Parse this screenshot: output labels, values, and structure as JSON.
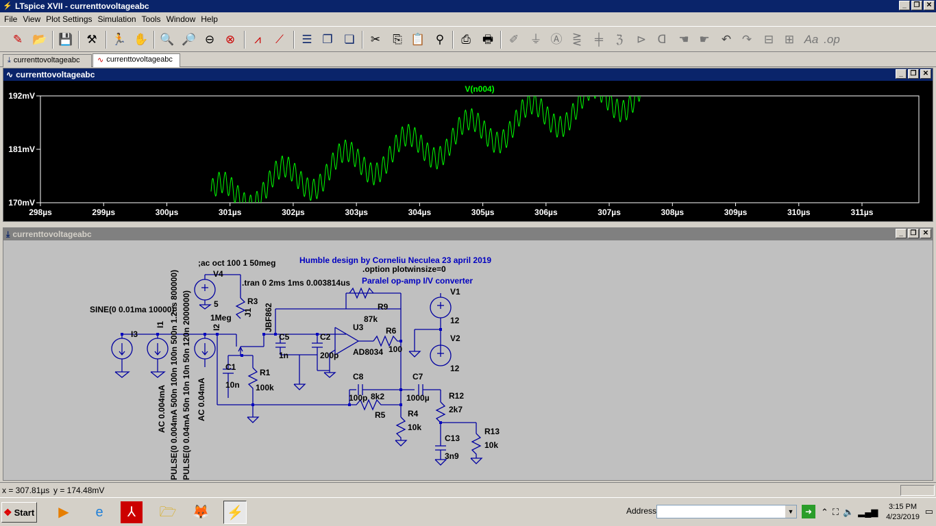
{
  "window": {
    "title": "LTspice XVII - currenttovoltageabc",
    "min": "_",
    "restore": "❐",
    "close": "✕"
  },
  "menu": [
    "File",
    "View",
    "Plot Settings",
    "Simulation",
    "Tools",
    "Window",
    "Help"
  ],
  "tabs": [
    {
      "label": "currenttovoltageabc",
      "icon": "schematic-icon"
    },
    {
      "label": "currenttovoltageabc",
      "icon": "waveform-icon"
    }
  ],
  "plot_window": {
    "title": "currenttovoltageabc"
  },
  "schematic_window": {
    "title": "currenttovoltageabc"
  },
  "chart_data": {
    "type": "line",
    "series": [
      {
        "name": "V(n004)",
        "color": "#00ff00"
      }
    ],
    "xticks": [
      "298µs",
      "299µs",
      "300µs",
      "301µs",
      "302µs",
      "303µs",
      "304µs",
      "305µs",
      "306µs",
      "307µs",
      "308µs",
      "309µs",
      "310µs",
      "311µs"
    ],
    "yticks": [
      "192mV",
      "181mV",
      "170mV"
    ],
    "xlim": [
      298,
      311.9
    ],
    "ylim": [
      170,
      192
    ],
    "x_unit": "µs",
    "y_unit": "mV",
    "background": "#000000",
    "trace_start": 300.7,
    "trace_end": 307.5,
    "trend": {
      "start_mV": 170.5,
      "end_mV": 193
    },
    "ripple_period_us": 0.1,
    "ripple_amp_mV": 2.2
  },
  "schematic": {
    "labels": [
      {
        "text": "Humble design by Corneliu Neculea 23 april 2019",
        "color": "#0000c0"
      },
      {
        "text": ".option plotwinsize=0",
        "color": "#000000"
      },
      {
        "text": "Paralel op-amp I/V converter",
        "color": "#0000c0"
      },
      {
        "text": ";ac oct 100 1 50meg",
        "color": "#000000"
      },
      {
        "text": ".tran 0 2ms 1ms 0.003814us",
        "color": "#000000"
      },
      {
        "text": "SINE(0 0.01ma 10000)",
        "color": "#000000"
      },
      {
        "text": "V4"
      },
      {
        "text": "5"
      },
      {
        "text": "R3"
      },
      {
        "text": "1Meg"
      },
      {
        "text": "J1"
      },
      {
        "text": "JBF862"
      },
      {
        "text": "C5"
      },
      {
        "text": "1n"
      },
      {
        "text": "C2"
      },
      {
        "text": "200p"
      },
      {
        "text": "R9"
      },
      {
        "text": "87k"
      },
      {
        "text": "U3"
      },
      {
        "text": "AD8034"
      },
      {
        "text": "R6"
      },
      {
        "text": "100"
      },
      {
        "text": "V1"
      },
      {
        "text": "12"
      },
      {
        "text": "V2"
      },
      {
        "text": "12"
      },
      {
        "text": "I3"
      },
      {
        "text": "I1"
      },
      {
        "text": "I2"
      },
      {
        "text": "C1"
      },
      {
        "text": "10n"
      },
      {
        "text": "R1"
      },
      {
        "text": "100k"
      },
      {
        "text": "C8"
      },
      {
        "text": "100p"
      },
      {
        "text": "C7"
      },
      {
        "text": "1000µ"
      },
      {
        "text": "8k2"
      },
      {
        "text": "R5"
      },
      {
        "text": "R4"
      },
      {
        "text": "10k"
      },
      {
        "text": "R12"
      },
      {
        "text": "2k7"
      },
      {
        "text": "C13"
      },
      {
        "text": "3n9"
      },
      {
        "text": "R13"
      },
      {
        "text": "10k"
      },
      {
        "text": "AC 0.004mA"
      },
      {
        "text": "PULSE(0 0.004mA 500n 100n 100n 500n 1.2us 800000)"
      },
      {
        "text": "PULSE(0 0.04mA 50n 10n 10n 50n 120n 2000000)"
      },
      {
        "text": "AC 0.04mA"
      }
    ]
  },
  "status": {
    "x": "x = 307.81µs",
    "y": "y = 174.48mV"
  },
  "taskbar": {
    "start": "Start",
    "address_label": "Address",
    "time": "3:15 PM",
    "date": "4/23/2019"
  }
}
